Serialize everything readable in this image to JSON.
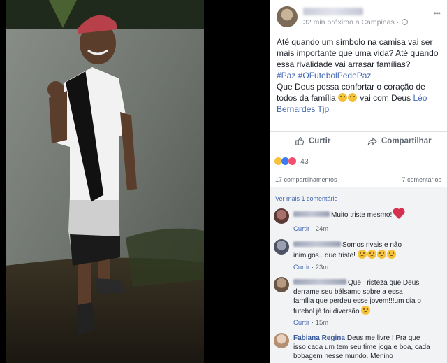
{
  "post": {
    "author_name": "",
    "meta": "32 min próximo a Campinas ·",
    "text_line1": "Até quando um símbolo na camisa vai ser mais importante que uma vida? Até quando essa rivalidade vai arrasar famílias?",
    "hashtags": "#Paz #OFutebolPedePaz",
    "text_line2": "Que Deus possa confortar o coração de todos da família",
    "text_line2_suffix": "vai com Deus",
    "tagged_person": "Léo Bernardes Tjp"
  },
  "actions": {
    "like_label": "Curtir",
    "share_label": "Compartilhar"
  },
  "reactions": {
    "count": "43",
    "types": [
      "sad",
      "like",
      "love"
    ]
  },
  "stats": {
    "shares": "17 compartilhamentos",
    "comments": "7 comentários"
  },
  "comments_section": {
    "view_more": "Ver mais 1 comentário",
    "like_label": "Curtir",
    "items": [
      {
        "author": "",
        "text": "Muito triste mesmo!",
        "time": "24m"
      },
      {
        "author": "",
        "text": "Somos rivais e não inimigos.. que triste!",
        "time": "23m"
      },
      {
        "author": "",
        "text": "Que Tristeza que Deus derrame seu bálsamo sobre a essa família que perdeu esse jovem!!!um dia o futebol já foi diversão",
        "time": "15m"
      },
      {
        "author": "Fabiana Regina",
        "text": "Deus me livre ! Pra que isso cada um tem seu time joga e boa, cada bobagem nesse mundo. Menino",
        "time": ""
      }
    ]
  },
  "icons": {
    "more": "more-horizontal-icon",
    "like": "thumbs-up-icon",
    "share": "share-arrow-icon",
    "privacy": "globe-icon"
  },
  "colors": {
    "link": "#4267b2",
    "secondary_text": "#606770",
    "comments_bg": "#f2f3f5"
  }
}
